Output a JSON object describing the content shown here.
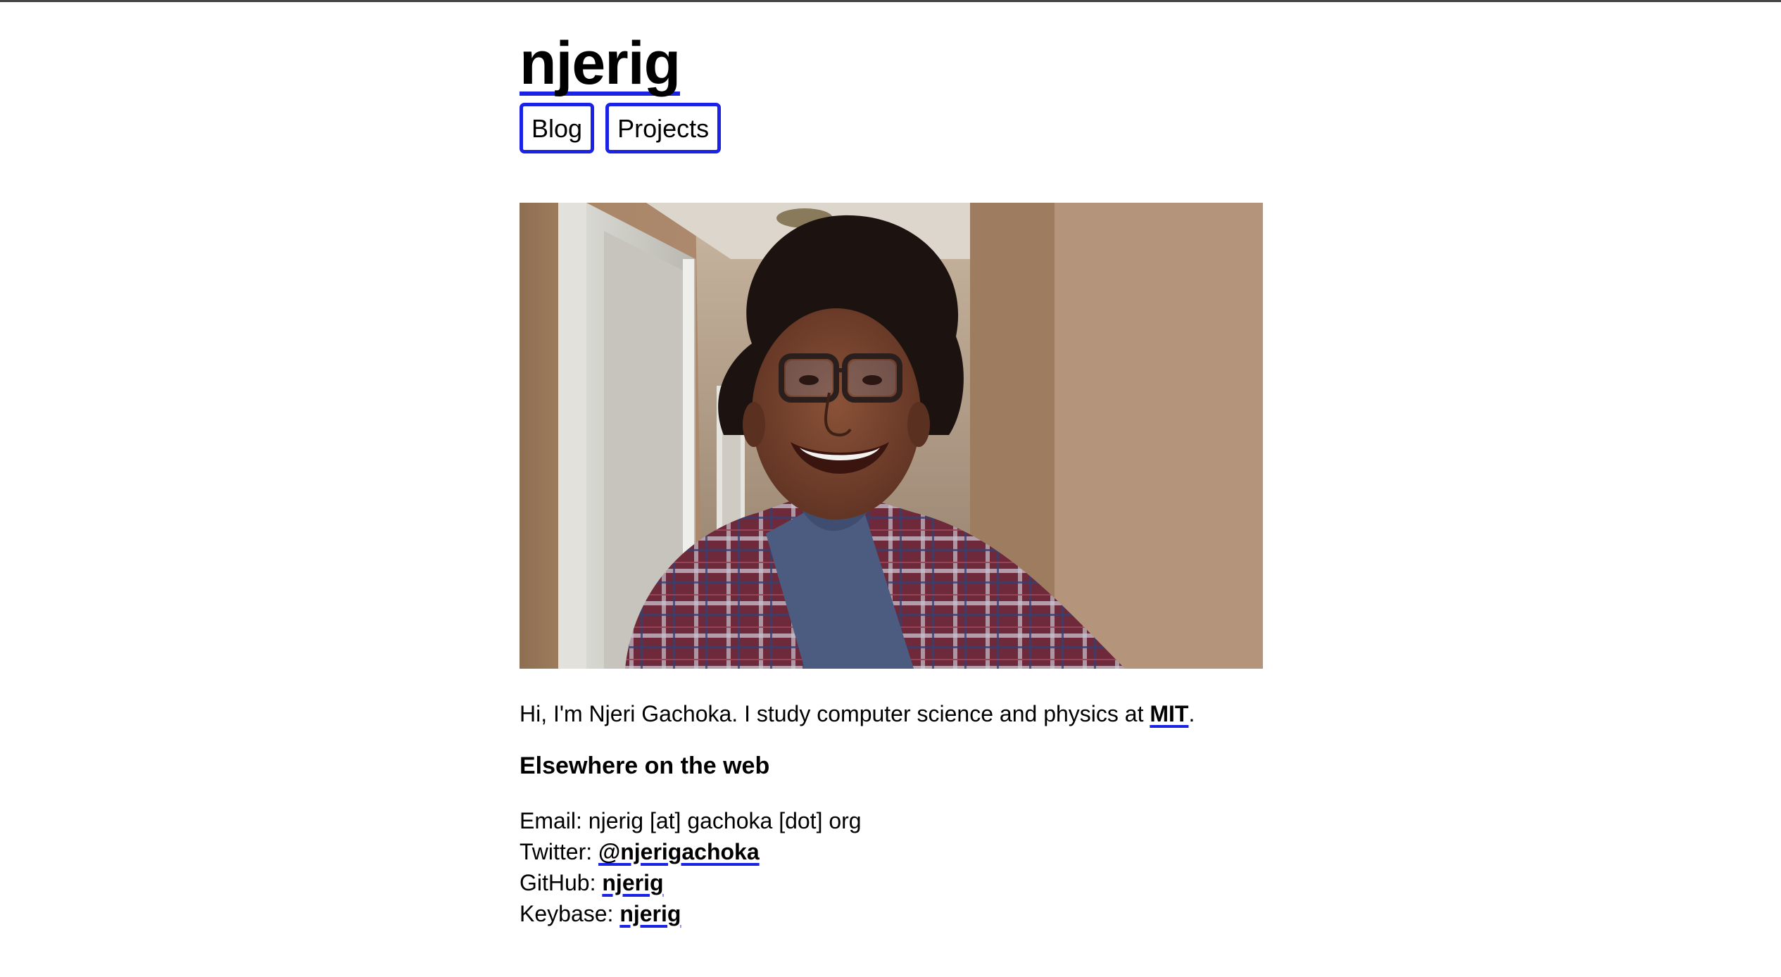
{
  "site": {
    "title": "njerig"
  },
  "nav": {
    "items": [
      {
        "label": "Blog"
      },
      {
        "label": "Projects"
      }
    ]
  },
  "photo": {
    "alt": "Photo of Njeri Gachoka"
  },
  "intro": {
    "text_before": "Hi, I'm Njeri Gachoka. I study computer science and physics at ",
    "link_label": "MIT",
    "text_after": "."
  },
  "elsewhere": {
    "heading": "Elsewhere on the web",
    "email": {
      "label": "Email: ",
      "value": "njerig [at] gachoka [dot] org"
    },
    "twitter": {
      "label": "Twitter: ",
      "link": "@njerigachoka"
    },
    "github": {
      "label": "GitHub: ",
      "link": "njerig"
    },
    "keybase": {
      "label": "Keybase: ",
      "link": "njerig"
    }
  },
  "colors": {
    "accent": "#1a22e6",
    "text": "#000000",
    "background": "#ffffff"
  }
}
